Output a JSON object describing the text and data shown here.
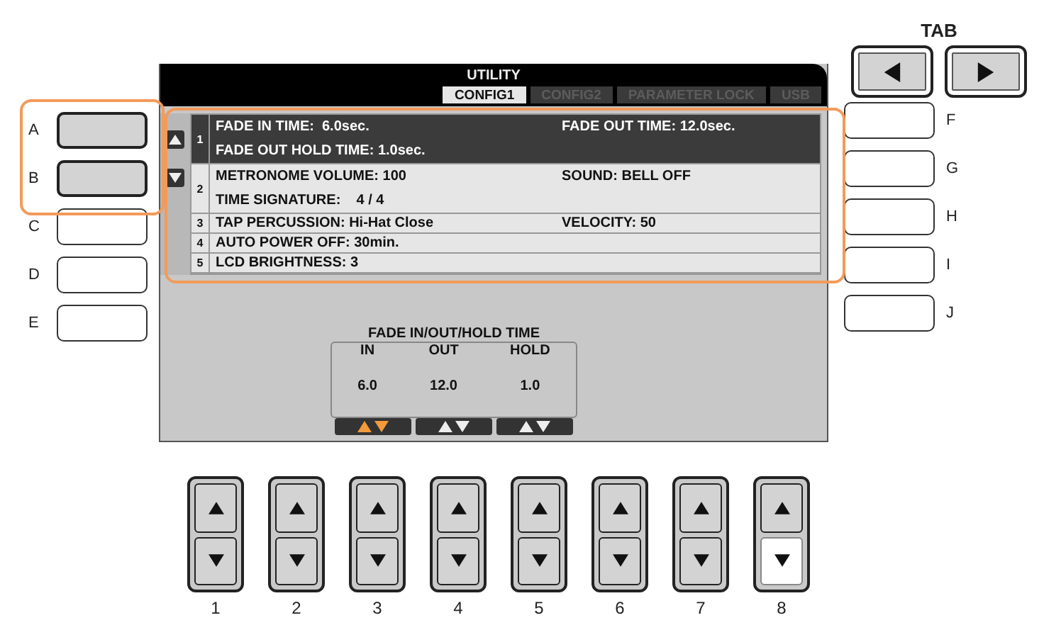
{
  "screen": {
    "title": "UTILITY",
    "tabs": [
      {
        "label": "CONFIG1",
        "selected": true
      },
      {
        "label": "CONFIG2",
        "selected": false
      },
      {
        "label": "PARAMETER LOCK",
        "selected": false
      },
      {
        "label": "USB",
        "selected": false
      }
    ],
    "rows": [
      {
        "number": "1",
        "selected": true,
        "lines": [
          [
            "FADE IN TIME:  6.0sec.",
            "FADE OUT TIME: 12.0sec."
          ],
          [
            "FADE OUT HOLD TIME: 1.0sec."
          ]
        ]
      },
      {
        "number": "2",
        "selected": false,
        "lines": [
          [
            "METRONOME VOLUME: 100",
            "SOUND: BELL OFF"
          ],
          [
            "TIME SIGNATURE:    4 / 4"
          ]
        ]
      },
      {
        "number": "3",
        "selected": false,
        "lines": [
          [
            "TAP PERCUSSION: Hi-Hat Close",
            "VELOCITY: 50"
          ]
        ]
      },
      {
        "number": "4",
        "selected": false,
        "lines": [
          [
            "AUTO POWER OFF: 30min."
          ]
        ]
      },
      {
        "number": "5",
        "selected": false,
        "lines": [
          [
            "LCD BRIGHTNESS: 3"
          ]
        ]
      }
    ],
    "fade_panel": {
      "title": "FADE IN/OUT/HOLD TIME",
      "columns": [
        {
          "label": "IN",
          "value": "6.0",
          "selected": true
        },
        {
          "label": "OUT",
          "value": "12.0",
          "selected": false
        },
        {
          "label": "HOLD",
          "value": "1.0",
          "selected": false
        }
      ]
    }
  },
  "left_buttons": [
    {
      "label": "A",
      "active": true
    },
    {
      "label": "B",
      "active": true
    },
    {
      "label": "C",
      "active": false
    },
    {
      "label": "D",
      "active": false
    },
    {
      "label": "E",
      "active": false
    }
  ],
  "right_buttons": [
    {
      "label": "F",
      "active": false
    },
    {
      "label": "G",
      "active": false
    },
    {
      "label": "H",
      "active": false
    },
    {
      "label": "I",
      "active": false
    },
    {
      "label": "J",
      "active": false
    }
  ],
  "tab_buttons": {
    "label": "TAB",
    "active": true
  },
  "data_buttons": [
    {
      "label": "1",
      "up_active": true,
      "down_active": true
    },
    {
      "label": "2",
      "up_active": true,
      "down_active": true
    },
    {
      "label": "3",
      "up_active": true,
      "down_active": true
    },
    {
      "label": "4",
      "up_active": true,
      "down_active": true
    },
    {
      "label": "5",
      "up_active": true,
      "down_active": true
    },
    {
      "label": "6",
      "up_active": true,
      "down_active": true
    },
    {
      "label": "7",
      "up_active": true,
      "down_active": true
    },
    {
      "label": "8",
      "up_active": true,
      "down_active": false
    }
  ]
}
